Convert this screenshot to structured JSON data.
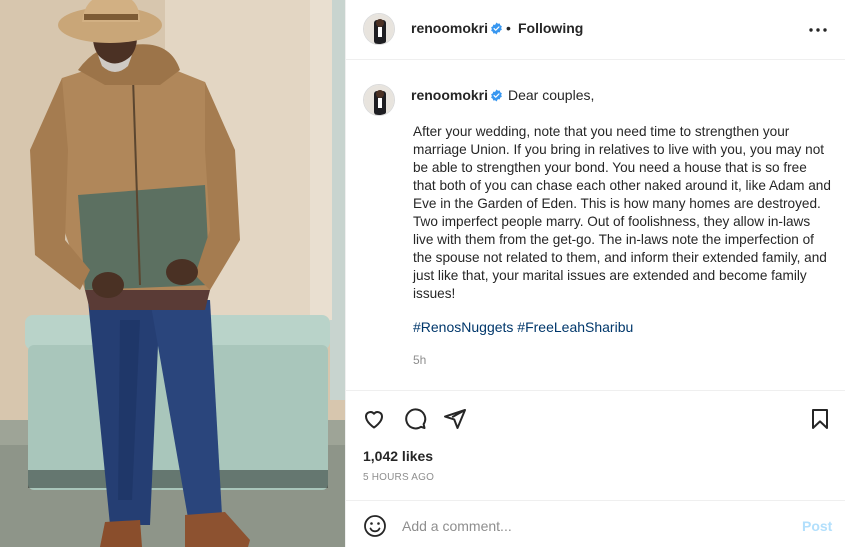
{
  "header": {
    "username": "renoomokri",
    "separator": "•",
    "follow_status": "Following"
  },
  "caption": {
    "username": "renoomokri",
    "greeting": "Dear couples,",
    "body": "After your wedding, note that you need time to strengthen your marriage Union. If you bring in relatives to live with you, you may not be able to strengthen your bond. You need a house that is so free that both of you can chase each other naked around it, like Adam and Eve in the Garden of Eden. This is how many homes are destroyed. Two imperfect people marry. Out of foolishness, they allow in-laws live with them from the get-go. The in-laws note the imperfection of the spouse not related to them, and inform their extended family, and just like that, your marital issues are extended and become family issues!",
    "hashtags": [
      "#RenosNuggets",
      "#FreeLeahSharibu"
    ],
    "time": "5h"
  },
  "stats": {
    "likes": "1,042 likes",
    "posted_ago": "5 HOURS AGO"
  },
  "comment": {
    "placeholder": "Add a comment...",
    "post_label": "Post"
  },
  "colors": {
    "verified": "#3897f0",
    "hashtag": "#00376b",
    "post_disabled": "#b2dffc",
    "muted": "#8e8e8e"
  },
  "icons": [
    "more-options-icon",
    "verified-badge-icon",
    "heart-icon",
    "comment-icon",
    "share-icon",
    "bookmark-icon",
    "emoji-icon"
  ]
}
